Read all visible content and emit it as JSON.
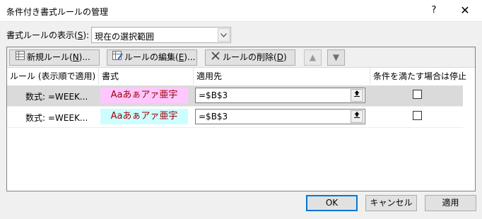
{
  "window": {
    "title": "条件付き書式ルールの管理",
    "help_label": "?",
    "close_label": "✕"
  },
  "display": {
    "label_prefix": "書式ルールの表示(",
    "label_key": "S",
    "label_suffix": "):",
    "selected_scope": "現在の選択範囲"
  },
  "toolbar": {
    "new_rule": {
      "prefix": "新規ルール(",
      "key": "N",
      "suffix": ")..."
    },
    "edit_rule": {
      "prefix": "ルールの編集(",
      "key": "E",
      "suffix": ")..."
    },
    "delete_rule": {
      "prefix": "ルールの削除(",
      "key": "D",
      "suffix": ")"
    },
    "move_up_label": "▲",
    "move_down_label": "▼"
  },
  "columns": {
    "rule": "ルール (表示順で適用)",
    "format": "書式",
    "applies_to": "適用先",
    "stop_if_true": "条件を満たす場合は停止"
  },
  "rules": [
    {
      "rule": "数式: =WEEK...",
      "format_preview": "Aaあぁアァ亜宇",
      "format_fill": "#ffc7ff",
      "applies_to": "=$B$3",
      "stop_if_true": false,
      "selected": true
    },
    {
      "rule": "数式: =WEEK...",
      "format_preview": "Aaあぁアァ亜宇",
      "format_fill": "#cdfeff",
      "applies_to": "=$B$3",
      "stop_if_true": false,
      "selected": false
    }
  ],
  "buttons": {
    "ok": "OK",
    "cancel": "キャンセル",
    "apply": "適用"
  },
  "icons": {
    "help": "help-icon",
    "close": "close-icon",
    "dropdown": "chevron-down-icon",
    "new_rule": "new-rule-icon",
    "edit_rule": "edit-rule-icon",
    "delete_rule": "delete-x-icon",
    "move_up": "arrow-up-icon",
    "move_down": "arrow-down-icon",
    "collapse": "collapse-dialog-icon"
  }
}
